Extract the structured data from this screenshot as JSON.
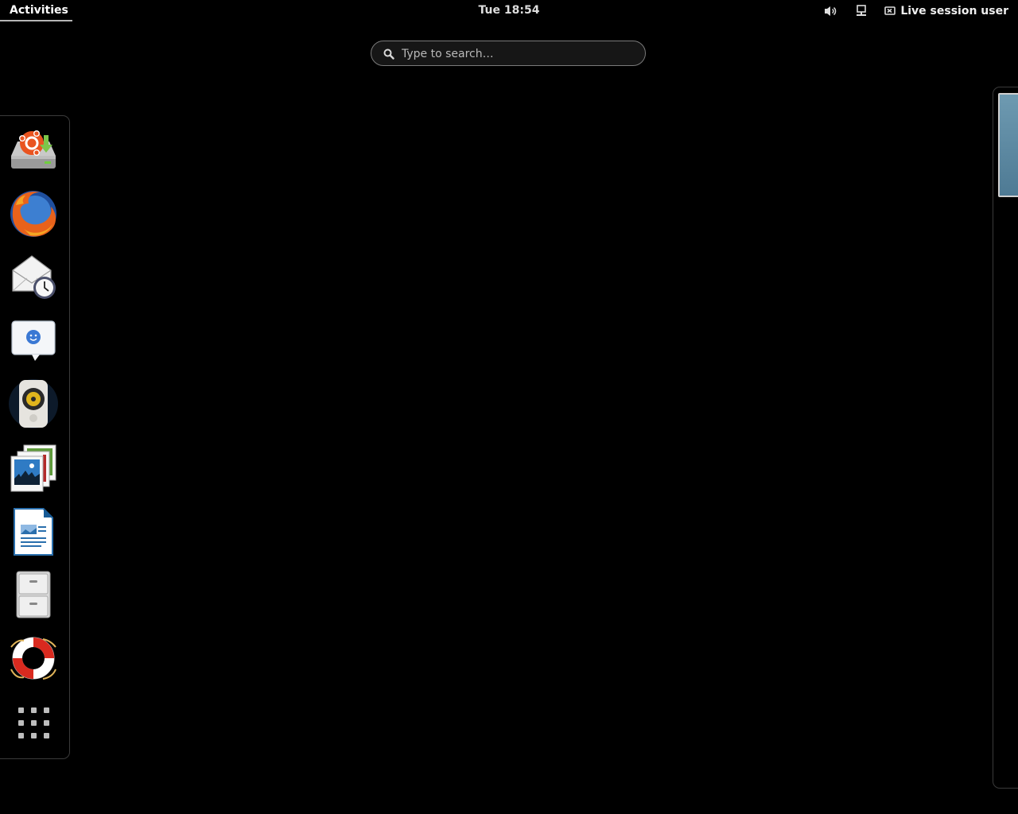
{
  "topbar": {
    "activities_label": "Activities",
    "clock": "Tue 18:54",
    "user_label": "Live session user",
    "tray_icons": [
      "volume-icon",
      "network-wired-icon",
      "user-menu-icon"
    ]
  },
  "search": {
    "placeholder": "Type to search…",
    "value": ""
  },
  "dash": {
    "items": [
      {
        "name": "install-ubuntu-gnome-icon"
      },
      {
        "name": "firefox-icon"
      },
      {
        "name": "evolution-mail-icon"
      },
      {
        "name": "empathy-chat-icon"
      },
      {
        "name": "rhythmbox-icon"
      },
      {
        "name": "shotwell-photos-icon"
      },
      {
        "name": "libreoffice-writer-icon"
      },
      {
        "name": "files-icon"
      },
      {
        "name": "help-icon"
      },
      {
        "name": "show-applications-icon"
      }
    ]
  },
  "workspaces": {
    "count": 1
  }
}
